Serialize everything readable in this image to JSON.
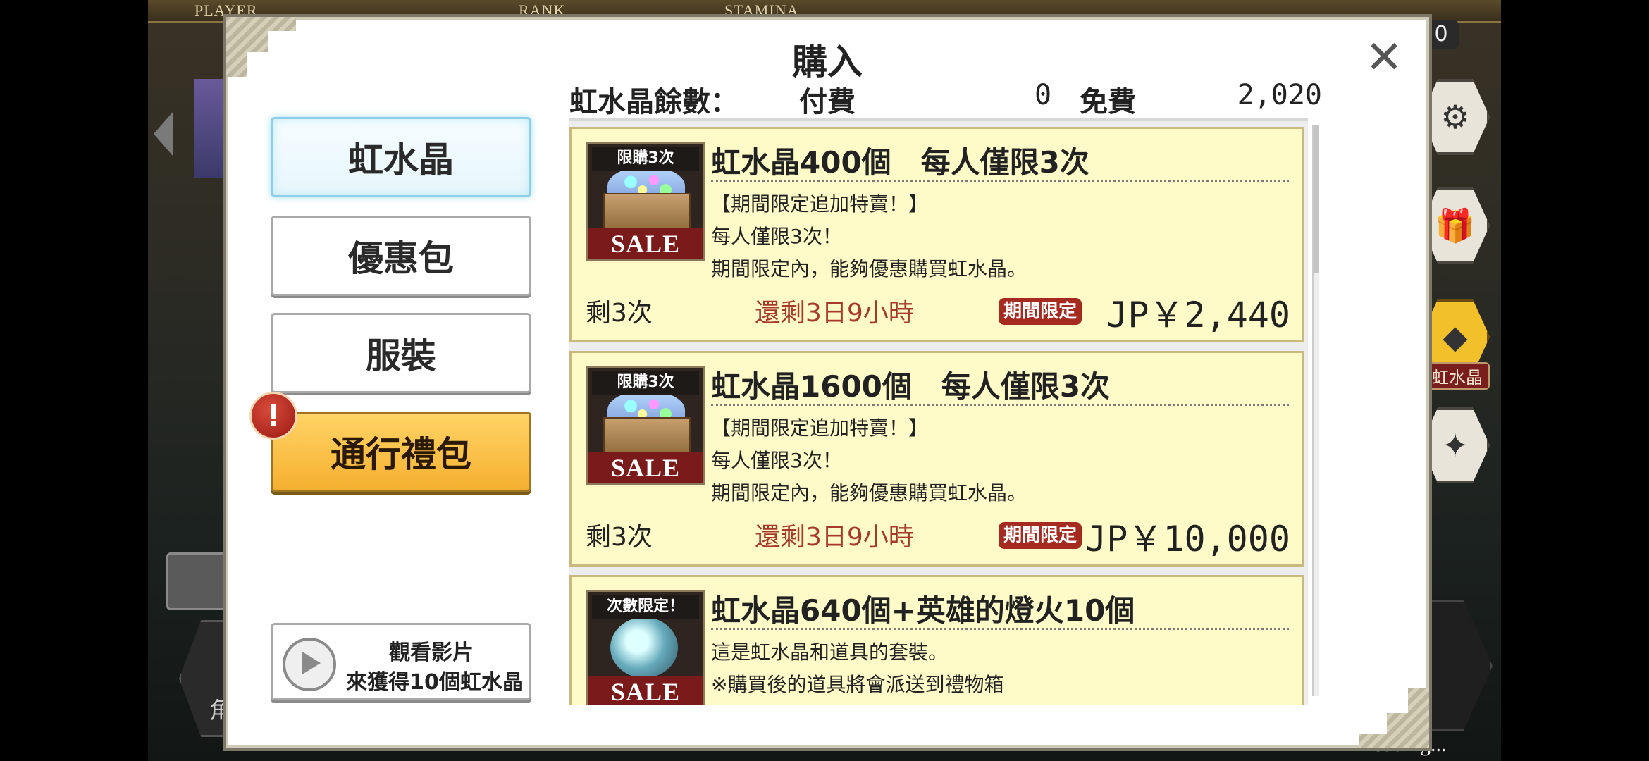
{
  "background": {
    "hud_labels": [
      "PLAYER",
      "RANK",
      "STAMINA"
    ],
    "top_right_value": "0",
    "side_label": "虹水晶",
    "left_label": "角",
    "loading_text": "Loading..."
  },
  "modal": {
    "title": "購入",
    "close_icon": "close-icon"
  },
  "balance": {
    "label": "虹水晶餘數：",
    "paid_label": "付費",
    "paid_value": "0",
    "free_label": "免費",
    "free_value": "2,020"
  },
  "tabs": [
    {
      "label": "虹水晶",
      "state": "active"
    },
    {
      "label": "優惠包",
      "state": "normal"
    },
    {
      "label": "服裝",
      "state": "normal"
    },
    {
      "label": "通行禮包",
      "state": "highlight",
      "alert": "!"
    }
  ],
  "video_button": {
    "line1": "觀看影片",
    "line2": "來獲得10個虹水晶"
  },
  "items": [
    {
      "icon_tag": "限購3次",
      "icon_sale": "SALE",
      "title": "虹水晶400個　每人僅限3次",
      "desc": "【期間限定追加特賣！】\n每人僅限3次！\n期間限定內，能夠優惠購買虹水晶。",
      "remaining": "剩3次",
      "time_left": "還剩3日9小時",
      "limited_badge": "期間限定",
      "price": "JP￥2,440"
    },
    {
      "icon_tag": "限購3次",
      "icon_sale": "SALE",
      "title": "虹水晶1600個　每人僅限3次",
      "desc": "【期間限定追加特賣！】\n每人僅限3次！\n期間限定內，能夠優惠購買虹水晶。",
      "remaining": "剩3次",
      "time_left": "還剩3日9小時",
      "limited_badge": "期間限定",
      "price": "JP￥10,000"
    },
    {
      "icon_tag": "次數限定！",
      "icon_sale": "SALE",
      "title": "虹水晶640個+英雄的燈火10個",
      "desc": "這是虹水晶和道具的套裝。\n※購買後的道具將會派送到禮物箱",
      "remaining": "",
      "time_left": "",
      "limited_badge": "",
      "price": ""
    }
  ],
  "colors": {
    "item_bg": "#fefbc8",
    "time_text": "#a63a2a",
    "limited_badge": "#a52a20",
    "gold_tab": "#f5b030",
    "active_tab_border": "#8ccfe6"
  }
}
